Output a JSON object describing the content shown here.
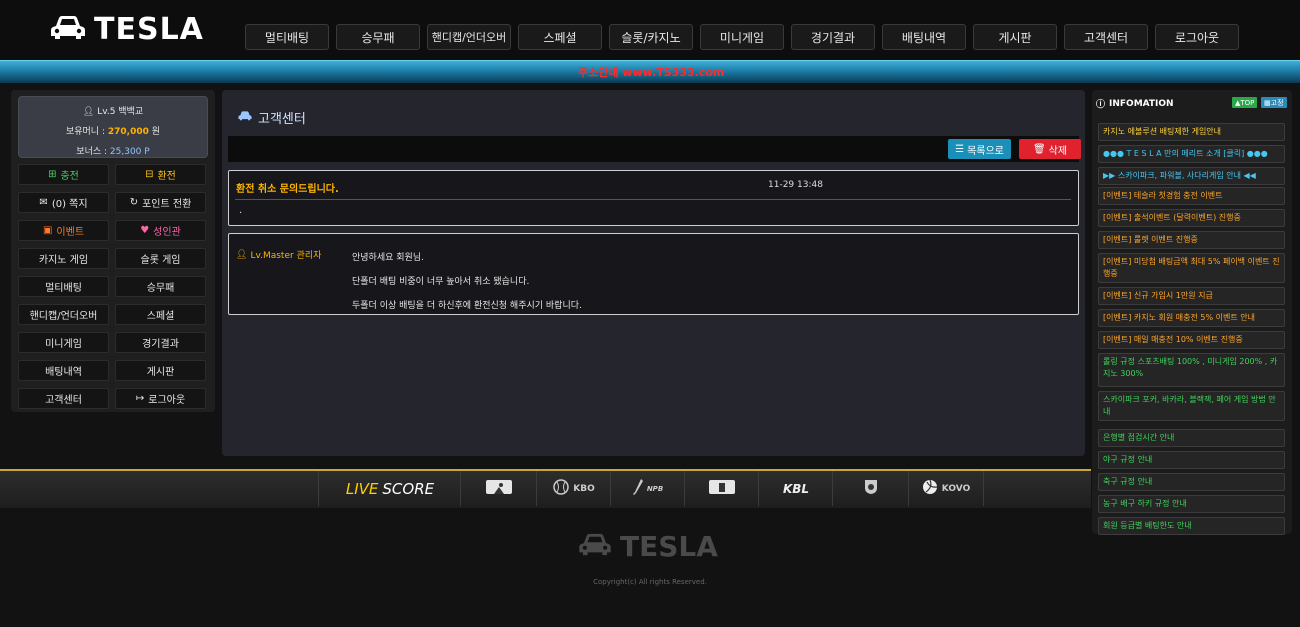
{
  "brand": {
    "name": "TESLA"
  },
  "colors": {
    "accent_gold": "#ffb400",
    "ticker_text": "#ff2a2a",
    "list_button": "#1b8fb8",
    "delete_button": "#e0222f"
  },
  "nav": [
    {
      "label": "멀티배팅"
    },
    {
      "label": "승무패"
    },
    {
      "label": "핸디캡/언더오버"
    },
    {
      "label": "스페셜"
    },
    {
      "label": "슬롯/카지노"
    },
    {
      "label": "미니게임"
    },
    {
      "label": "경기결과"
    },
    {
      "label": "배팅내역"
    },
    {
      "label": "게시판"
    },
    {
      "label": "고객센터"
    },
    {
      "label": "로그아웃"
    }
  ],
  "ticker": {
    "text": "주소안내 www.TS333.com"
  },
  "user": {
    "level_name": "Lv.5 백백교",
    "money_label": "보유머니 :",
    "money_value": "270,000",
    "money_unit": "원",
    "bonus_label": "보너스 :",
    "bonus_value": "25,300 P"
  },
  "side_menu": {
    "charge": "충전",
    "exchange": "환전",
    "messages": "(0) 쪽지",
    "point_convert": "포인트 전환",
    "event": "이벤트",
    "adult": "성인관",
    "casino_game": "카지노 게임",
    "slot_game": "슬롯 게임",
    "multi_bet": "멀티배팅",
    "win_lose": "승무패",
    "handicap": "핸디캡/언더오버",
    "special": "스페셜",
    "mini_game": "미니게임",
    "results": "경기결과",
    "bet_history": "배팅내역",
    "board": "게시판",
    "customer_center": "고객센터",
    "logout": "로그아웃"
  },
  "main": {
    "title": "고객센터",
    "list_button": "목록으로",
    "delete_button": "삭제",
    "post": {
      "title": "환전 취소 문의드립니다.",
      "date": "11-29 13:48",
      "body": "."
    },
    "reply": {
      "author": "Lv.Master 관리자",
      "lines": [
        "안녕하세요 회원님.",
        "단폴더 배팅 비중이 너무 높아서 취소 됐습니다.",
        "두폴더 이상 배팅을 더 하신후에 환전신청 해주시기 바랍니다."
      ]
    }
  },
  "info": {
    "title": "INFOMATION",
    "top_badge": "TOP",
    "fixed_badge": "고정",
    "items": [
      {
        "text": "카지노 에볼루션 배팅제한 게임안내",
        "color": "#ffd23a"
      },
      {
        "text": "●●● T E S L A 만의 메리트 소개 [클릭] ●●●",
        "color": "#45c7ef"
      },
      {
        "text": "▶▶ 스카이파크, 파워볼, 사다리게임 안내 ◀◀",
        "color": "#45c7ef"
      },
      {
        "text": "[이벤트] 테슬라 첫경험 충전 이벤트",
        "color": "#ffa62a"
      },
      {
        "text": "[이벤트] 출석이벤트 (달력이벤트) 진행중",
        "color": "#ffa62a"
      },
      {
        "text": "[이벤트] 룰렛 이벤트 진행중",
        "color": "#ffa62a"
      },
      {
        "text": "[이벤트] 미당첨 배팅금액 최대 5% 페이백 이벤트 진행중",
        "color": "#ffa62a"
      },
      {
        "text": "[이벤트] 신규 가입시 1만원 지급",
        "color": "#ffa62a"
      },
      {
        "text": "[이벤트] 카지노 회원 매충전 5% 이벤트 안내",
        "color": "#ffa62a"
      },
      {
        "text": "[이벤트] 매일 매충전 10% 이벤트 진행중",
        "color": "#ffa62a"
      },
      {
        "text": "롤링 규정 스포츠배팅 100% , 미니게임 200% , 카지노 300%",
        "color": "#3fd35b"
      },
      {
        "text": "스카이파크 포커, 바카라, 블랙잭, 페어 게임 방법 안내",
        "color": "#3fd35b"
      },
      {
        "text": "은행별 점검시간 안내",
        "color": "#3fd35b"
      },
      {
        "text": "야구 규정 안내",
        "color": "#3fd35b"
      },
      {
        "text": "축구 규정 안내",
        "color": "#3fd35b"
      },
      {
        "text": "농구 배구 하키 규정 안내",
        "color": "#3fd35b"
      },
      {
        "text": "회원 등급별 배팅한도 안내",
        "color": "#3fd35b"
      }
    ]
  },
  "scorebar": {
    "live": "LIVE",
    "score": "SCORE",
    "kbo": "KBO",
    "npb": "NPB",
    "kbl": "KBL",
    "kovo": "KOVO"
  },
  "footer": {
    "logo": "TESLA",
    "copyright": "Copyright(c) All rights Reserved."
  }
}
